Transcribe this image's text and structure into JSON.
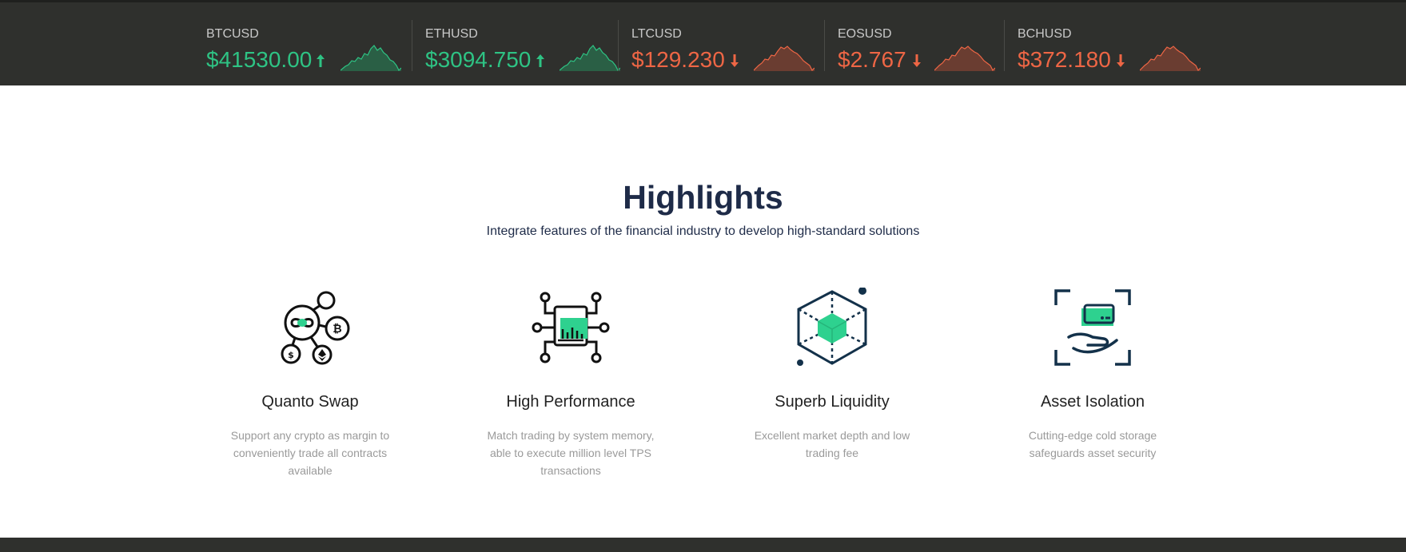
{
  "tickers": [
    {
      "symbol": "BTCUSD",
      "price": "$41530.00",
      "trend": "up"
    },
    {
      "symbol": "ETHUSD",
      "price": "$3094.750",
      "trend": "up"
    },
    {
      "symbol": "LTCUSD",
      "price": "$129.230",
      "trend": "down"
    },
    {
      "symbol": "EOSUSD",
      "price": "$2.767",
      "trend": "down"
    },
    {
      "symbol": "BCHUSD",
      "price": "$372.180",
      "trend": "down"
    }
  ],
  "colors": {
    "up": "#2ec384",
    "down": "#ee6645",
    "accent": "#2ed18f",
    "navy": "#13314a",
    "bar": "#2f302d"
  },
  "highlights": {
    "title": "Highlights",
    "subtitle": "Integrate features of the financial industry to develop high-standard solutions",
    "features": [
      {
        "icon": "network-icon",
        "title": "Quanto Swap",
        "desc": "Support any crypto as margin to conveniently trade all contracts available"
      },
      {
        "icon": "chip-icon",
        "title": "High Performance",
        "desc": "Match trading by system memory, able to execute million level TPS transactions"
      },
      {
        "icon": "cube-icon",
        "title": "Superb Liquidity",
        "desc": "Excellent market depth and low trading fee"
      },
      {
        "icon": "hand-card-icon",
        "title": "Asset Isolation",
        "desc": "Cutting-edge cold storage safeguards asset security"
      }
    ]
  }
}
